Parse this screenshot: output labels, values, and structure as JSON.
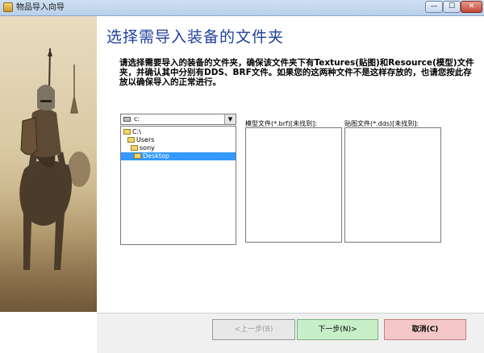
{
  "window": {
    "title": "物品导入向导",
    "min_icon": "minimize-icon",
    "max_icon": "maximize-icon",
    "close_icon": "close-icon",
    "min_glyph": "—",
    "max_glyph": "☐",
    "close_glyph": "✕"
  },
  "page": {
    "title": "选择需导入装备的文件夹",
    "instructions": "请选择需要导入的装备的文件夹，确保该文件夹下有Textures(贴图)和Resource(模型)文件夹，并确认其中分别有DDS、BRF文件。如果您的这两种文件不是这样存放的，也请您按此存放以确保导入的正常进行。"
  },
  "drive": {
    "value": "c:",
    "arrow": "▼"
  },
  "folders": [
    {
      "label": "C:\\",
      "selected": false
    },
    {
      "label": "Users",
      "selected": false
    },
    {
      "label": "sony",
      "selected": false
    },
    {
      "label": "Desktop",
      "selected": true
    }
  ],
  "model_files": {
    "label": "模型文件(*.brf)[未找到]:"
  },
  "texture_files": {
    "label": "贴图文件(*.dds)[未找到]:"
  },
  "buttons": {
    "back": "<上一步(B)",
    "next": "下一步(N)>",
    "cancel": "取消(C)"
  },
  "colors": {
    "title": "#1f3f9e",
    "next_bg": "#c8f0c8",
    "cancel_bg": "#f4c8c8",
    "selected": "#3399ff"
  }
}
